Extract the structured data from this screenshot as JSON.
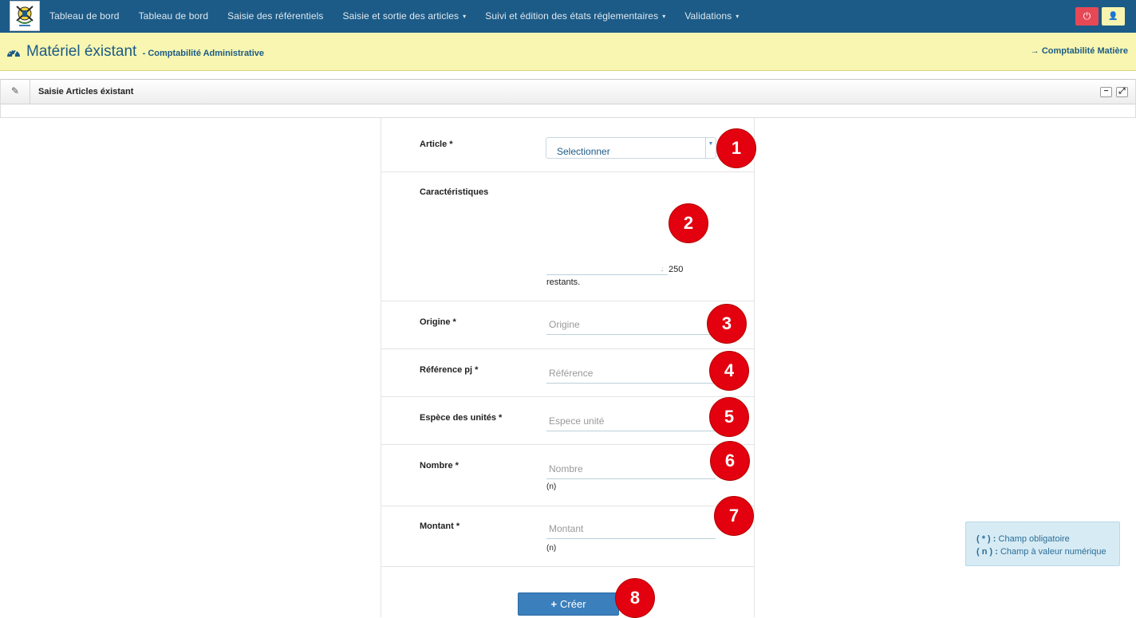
{
  "navbar": {
    "items": [
      {
        "label": "Tableau de bord",
        "dropdown": false
      },
      {
        "label": "Tableau de bord",
        "dropdown": false
      },
      {
        "label": "Saisie des référentiels",
        "dropdown": false
      },
      {
        "label": "Saisie et sortie des articles",
        "dropdown": true
      },
      {
        "label": "Suivi et édition des états réglementaires",
        "dropdown": true
      },
      {
        "label": "Validations",
        "dropdown": true
      }
    ],
    "caret": "▾",
    "power_icon": "power-icon",
    "user_icon": "user-icon"
  },
  "page_header": {
    "title": "Matériel éxistant",
    "subtitle": "- Comptabilité Administrative",
    "right_link": "Comptabilité Matière",
    "right_link_icon": "→"
  },
  "widget": {
    "title": "Saisie Articles éxistant",
    "minimize": "−",
    "maximize": "⤢"
  },
  "form": {
    "article": {
      "label": "Article *",
      "value": "Selectionner"
    },
    "caracteristiques": {
      "label": "Caractéristiques",
      "counter": "250",
      "counter_suffix": "restants.",
      "grip": ".:"
    },
    "origine": {
      "label": "Origine *",
      "placeholder": "Origine"
    },
    "reference": {
      "label": "Référence pj *",
      "placeholder": "Référence"
    },
    "espece": {
      "label": "Espèce des unités *",
      "placeholder": "Espece unité"
    },
    "nombre": {
      "label": "Nombre *",
      "placeholder": "Nombre",
      "hint": "(n)"
    },
    "montant": {
      "label": "Montant *",
      "placeholder": "Montant",
      "hint": "(n)"
    },
    "submit": {
      "icon": "+",
      "label": "Créer"
    }
  },
  "badges": [
    "1",
    "2",
    "3",
    "4",
    "5",
    "6",
    "7",
    "8"
  ],
  "legend": {
    "line1_key": "( * ) :",
    "line1_text": "Champ obligatoire",
    "line2_key": "( n ) :",
    "line2_text": "Champ à valeur numérique"
  },
  "colors": {
    "navbar": "#1c5b87",
    "header_bg": "#f8f6b0",
    "badge": "#e3000f",
    "primary_button": "#3c7fbd",
    "power": "#e74856"
  }
}
